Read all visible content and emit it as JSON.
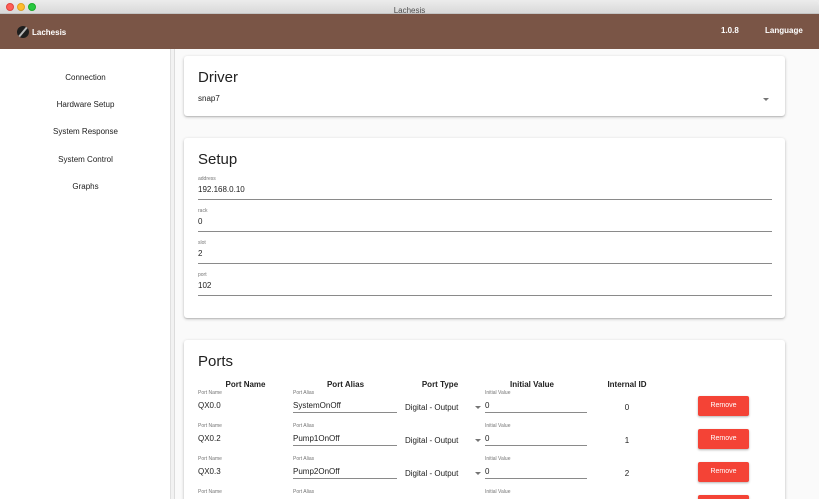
{
  "window": {
    "title": "Lachesis"
  },
  "appbar": {
    "brand": "Lachesis",
    "version": "1.0.8",
    "language_label": "Language"
  },
  "sidebar": {
    "items": [
      {
        "label": "Connection"
      },
      {
        "label": "Hardware Setup"
      },
      {
        "label": "System Response"
      },
      {
        "label": "System Control"
      },
      {
        "label": "Graphs"
      }
    ]
  },
  "driver": {
    "title": "Driver",
    "selected": "snap7"
  },
  "setup": {
    "title": "Setup",
    "fields": [
      {
        "label": "address",
        "value": "192.168.0.10"
      },
      {
        "label": "rack",
        "value": "0"
      },
      {
        "label": "slot",
        "value": "2"
      },
      {
        "label": "port",
        "value": "102"
      }
    ]
  },
  "ports": {
    "title": "Ports",
    "headers": {
      "port_name": "Port Name",
      "port_alias": "Port Alias",
      "port_type": "Port Type",
      "initial_value": "Initial Value",
      "internal_id": "Internal ID"
    },
    "field_labels": {
      "port_name": "Port Name",
      "port_alias": "Port Alias",
      "initial_value": "Initial Value"
    },
    "remove_label": "Remove",
    "rows": [
      {
        "name": "QX0.0",
        "alias": "SystemOnOff",
        "type": "Digital - Output",
        "initial_value": "0",
        "internal_id": "0"
      },
      {
        "name": "QX0.2",
        "alias": "Pump1OnOff",
        "type": "Digital - Output",
        "initial_value": "0",
        "internal_id": "1"
      },
      {
        "name": "QX0.3",
        "alias": "Pump2OnOff",
        "type": "Digital - Output",
        "initial_value": "0",
        "internal_id": "2"
      },
      {
        "name": "",
        "alias": "",
        "type": "",
        "initial_value": "",
        "internal_id": ""
      }
    ]
  }
}
